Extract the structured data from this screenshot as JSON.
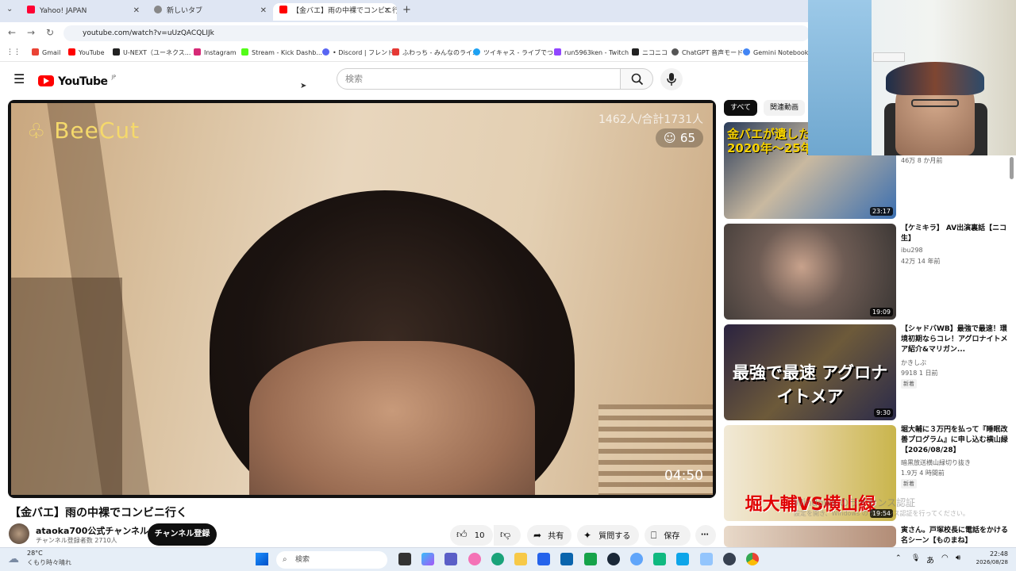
{
  "browser": {
    "tabs": [
      {
        "label": "Yahoo! JAPAN",
        "icon": "yahoo-icon"
      },
      {
        "label": "新しいタブ",
        "icon": "chrome-icon"
      },
      {
        "label": "【金バエ】雨の中裸でコンビニ行",
        "icon": "youtube-icon"
      }
    ],
    "url": "youtube.com/watch?v=uUzQACQLIJk",
    "bookmarks": [
      "Gmail",
      "YouTube",
      "U-NEXT（ユーネクス...",
      "Instagram",
      "Stream - Kick Dashb...",
      "• Discord | フレンド",
      "ふわっち - みんなのライ...",
      "ツイキャス - ライブでつ...",
      "run5963ken - Twitch",
      "ニコニコ",
      "ChatGPT 音声モード",
      "Gemini Notebook |"
    ]
  },
  "youtube": {
    "logo": "YouTube",
    "logo_region": "JP",
    "search_placeholder": "検索"
  },
  "video": {
    "overlay_brand": "BeeCut",
    "overlay_viewers": "1462人/合計1731人",
    "overlay_likes": "65",
    "overlay_timer": "04:50",
    "title": "【金バエ】雨の中裸でコンビニ行く",
    "channel": "ataoka700公式チャンネル",
    "subscribers": "チャンネル登録者数 2710人",
    "subscribe_label": "チャンネル登録",
    "like_count": "10",
    "share_label": "共有",
    "ask_label": "質問する",
    "save_label": "保存"
  },
  "sidebar": {
    "chips": [
      "すべて",
      "関連動画"
    ],
    "items": [
      {
        "thumb_text": "金バエが遺した 2020年〜25年",
        "duration": "23:17",
        "title": "",
        "channel": "",
        "meta": "46万 8 か月前",
        "badge": ""
      },
      {
        "thumb_text": "",
        "duration": "19:09",
        "title": "【ケミキラ】 AV出演裏話【ニコ生】",
        "channel": "ibu298",
        "meta": "42万 14 年前",
        "badge": ""
      },
      {
        "thumb_text": "最強で最速 アグロナイトメア",
        "duration": "9:30",
        "title": "【シャドバWB】最強で最速！環境初期ならコレ！アグロナイトメア紹介&マリガン...",
        "channel": "かきしぶ",
        "meta": "9918 1 日前",
        "badge": "新着"
      },
      {
        "thumb_text": "堀大輔VS横山緑",
        "duration": "19:54",
        "title": "堀大輔に３万円を払って『睡眠改善プログラム』に申し込む横山緑【2026/08/28】",
        "channel": "暗黒放送横山緑切り抜き",
        "meta": "1.9万 4 時間前",
        "badge": "新着"
      },
      {
        "thumb_text": "",
        "duration": "",
        "title": "寅さん。戸塚校長に電話をかける名シーン【ものまね】",
        "channel": "",
        "meta": "",
        "badge": ""
      }
    ]
  },
  "watermark": {
    "line1": "Windows のライセンス認証",
    "line2": "設定を開き、Windows のライセンス認証を行ってください。"
  },
  "taskbar": {
    "temp": "28°C",
    "weather": "くもり時々晴れ",
    "search_placeholder": "検索",
    "time": "22:48",
    "date": "2026/08/28"
  },
  "colors": {
    "youtube_red": "#ff0000",
    "subscribe_bg": "#0f0f0f",
    "tabstrip_bg": "#dfe6f3"
  }
}
